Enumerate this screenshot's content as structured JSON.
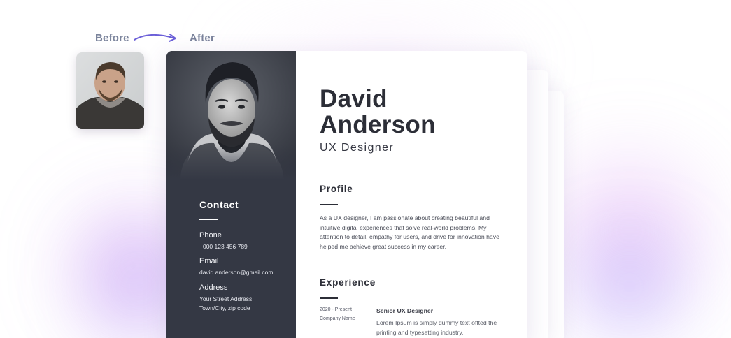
{
  "labels": {
    "before": "Before",
    "after": "After"
  },
  "resume": {
    "first_name": "David",
    "last_name": "Anderson",
    "job_title": "UX Designer",
    "contact": {
      "heading": "Contact",
      "phone_label": "Phone",
      "phone_value": "+000 123 456 789",
      "email_label": "Email",
      "email_value": "david.anderson@gmail.com",
      "address_label": "Address",
      "address_line1": "Your Street Address",
      "address_line2": "Town/City, zip code"
    },
    "profile": {
      "heading": "Profile",
      "text": "As a UX designer, I am passionate about creating beautiful and intuitive digital experiences that solve real-world problems. My attention to detail, empathy for users, and drive for innovation have helped me achieve great success in my career."
    },
    "experience": {
      "heading": "Experience",
      "items": [
        {
          "date": "2020 - Present",
          "company": "Company Name",
          "role": "Senior UX Designer",
          "description": "Lorem Ipsum is simply dummy text offted the printing and typesetting industry."
        }
      ]
    }
  },
  "colors": {
    "sidebar": "#343844",
    "accent_label": "#7b849c",
    "arrow": "#6b5fd8",
    "name_text": "#2c2e37"
  }
}
